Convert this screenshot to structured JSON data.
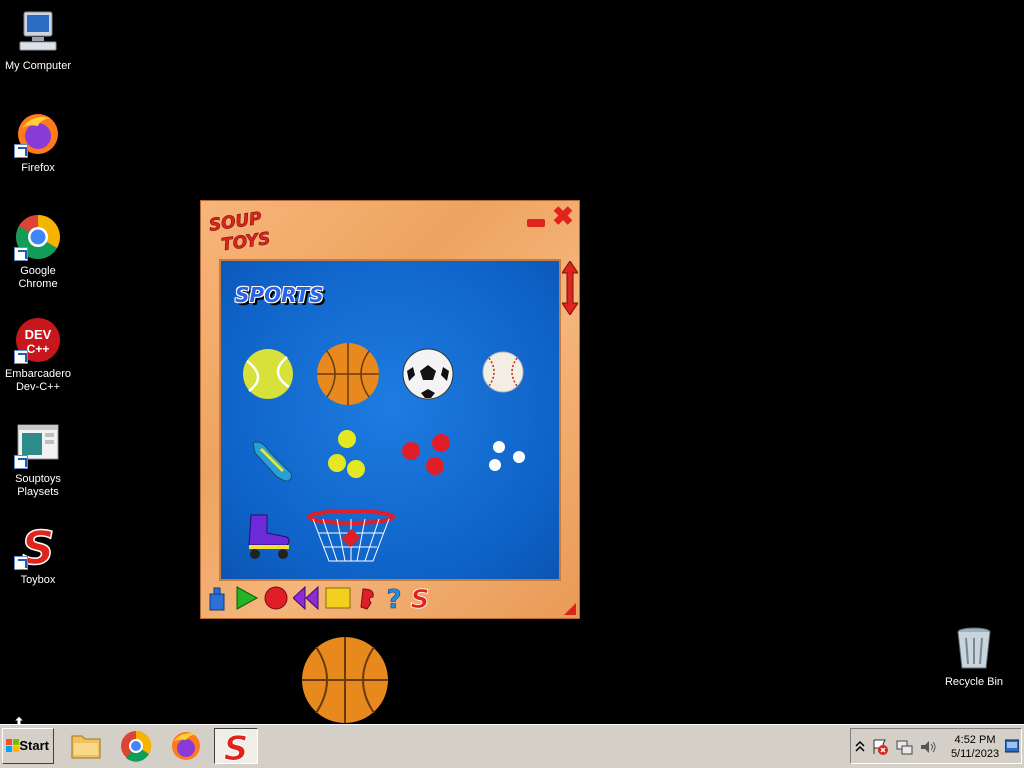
{
  "desktop": {
    "icons": [
      {
        "label": "My Computer",
        "icon": "computer-icon"
      },
      {
        "label": "Firefox",
        "icon": "firefox-icon"
      },
      {
        "label": "Google Chrome",
        "icon": "chrome-icon"
      },
      {
        "label": "Embarcadero Dev-C++",
        "icon": "devcpp-icon",
        "badge": "DEV C++"
      },
      {
        "label": "Souptoys Playsets",
        "icon": "playsets-icon"
      },
      {
        "label": "Toybox",
        "icon": "souptoys-s-icon"
      }
    ],
    "recycle_bin": {
      "label": "Recycle Bin",
      "icon": "recycle-bin-icon"
    }
  },
  "souptoys": {
    "logo_line1": "SOUP",
    "logo_line2": "TOYS",
    "section_title": "SPORTS",
    "toys": [
      "tennis ball",
      "basketball",
      "soccer ball",
      "baseball",
      "sneaker shoe",
      "tennis balls",
      "red balls",
      "ping pong balls",
      "roller skate",
      "basketball hoop"
    ],
    "toolbar": [
      "weight-icon",
      "play-icon",
      "record-icon",
      "rewind-icon",
      "stop-icon",
      "souptoys-figure-icon",
      "help-icon",
      "souptoys-s-icon"
    ],
    "colors": {
      "frame": "#f0a866",
      "playfield": "#1469d2",
      "accent_red": "#e0231d"
    }
  },
  "taskbar": {
    "start_label": "Start",
    "apps": [
      "file-explorer-icon",
      "chrome-icon",
      "firefox-icon",
      "souptoys-s-icon"
    ],
    "active_app": "souptoys-s-icon",
    "tray_icons": [
      "chevron-up-icon",
      "action-center-flag-icon",
      "network-icon",
      "volume-icon"
    ],
    "time": "4:52 PM",
    "date": "5/11/2023"
  }
}
